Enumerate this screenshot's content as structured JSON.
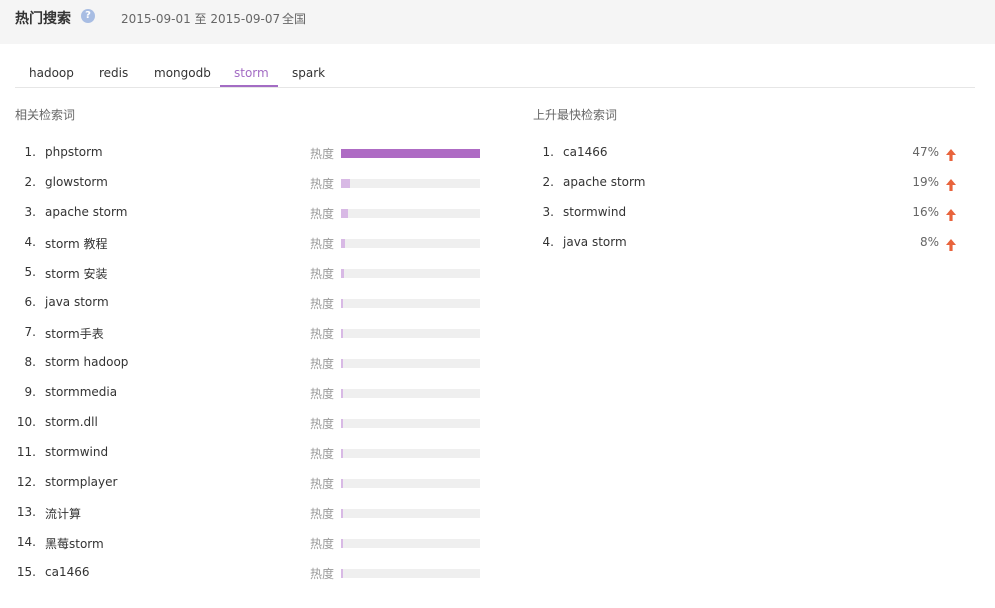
{
  "header": {
    "title": "热门搜索",
    "help_icon": "question-icon",
    "date_range": "2015-09-01 至 2015-09-07",
    "region": "全国"
  },
  "tabs": [
    {
      "label": "hadoop",
      "active": false
    },
    {
      "label": "redis",
      "active": false
    },
    {
      "label": "mongodb",
      "active": false
    },
    {
      "label": "storm",
      "active": true
    },
    {
      "label": "spark",
      "active": false
    }
  ],
  "related": {
    "title": "相关检索词",
    "heat_label": "热度",
    "items": [
      {
        "rank": "1.",
        "term": "phpstorm",
        "heat": 1.0
      },
      {
        "rank": "2.",
        "term": "glowstorm",
        "heat": 0.065
      },
      {
        "rank": "3.",
        "term": "apache storm",
        "heat": 0.05
      },
      {
        "rank": "4.",
        "term": "storm 教程",
        "heat": 0.03
      },
      {
        "rank": "5.",
        "term": "storm 安装",
        "heat": 0.025
      },
      {
        "rank": "6.",
        "term": "java storm",
        "heat": 0.01
      },
      {
        "rank": "7.",
        "term": "storm手表",
        "heat": 0.01
      },
      {
        "rank": "8.",
        "term": "storm hadoop",
        "heat": 0.01
      },
      {
        "rank": "9.",
        "term": "stormmedia",
        "heat": 0.01
      },
      {
        "rank": "10.",
        "term": "storm.dll",
        "heat": 0.01
      },
      {
        "rank": "11.",
        "term": "stormwind",
        "heat": 0.01
      },
      {
        "rank": "12.",
        "term": "stormplayer",
        "heat": 0.01
      },
      {
        "rank": "13.",
        "term": "流计算",
        "heat": 0.01
      },
      {
        "rank": "14.",
        "term": "黑莓storm",
        "heat": 0.01
      },
      {
        "rank": "15.",
        "term": "ca1466",
        "heat": 0.01
      }
    ]
  },
  "rising": {
    "title": "上升最快检索词",
    "items": [
      {
        "rank": "1.",
        "term": "ca1466",
        "pct": "47%"
      },
      {
        "rank": "2.",
        "term": "apache storm",
        "pct": "19%"
      },
      {
        "rank": "3.",
        "term": "stormwind",
        "pct": "16%"
      },
      {
        "rank": "4.",
        "term": "java storm",
        "pct": "8%"
      }
    ]
  },
  "colors": {
    "accent": "#a36cc4",
    "bar_top": "#ae6bc4",
    "bar_other": "#d8b9e5",
    "arrow": "#e8633c"
  }
}
